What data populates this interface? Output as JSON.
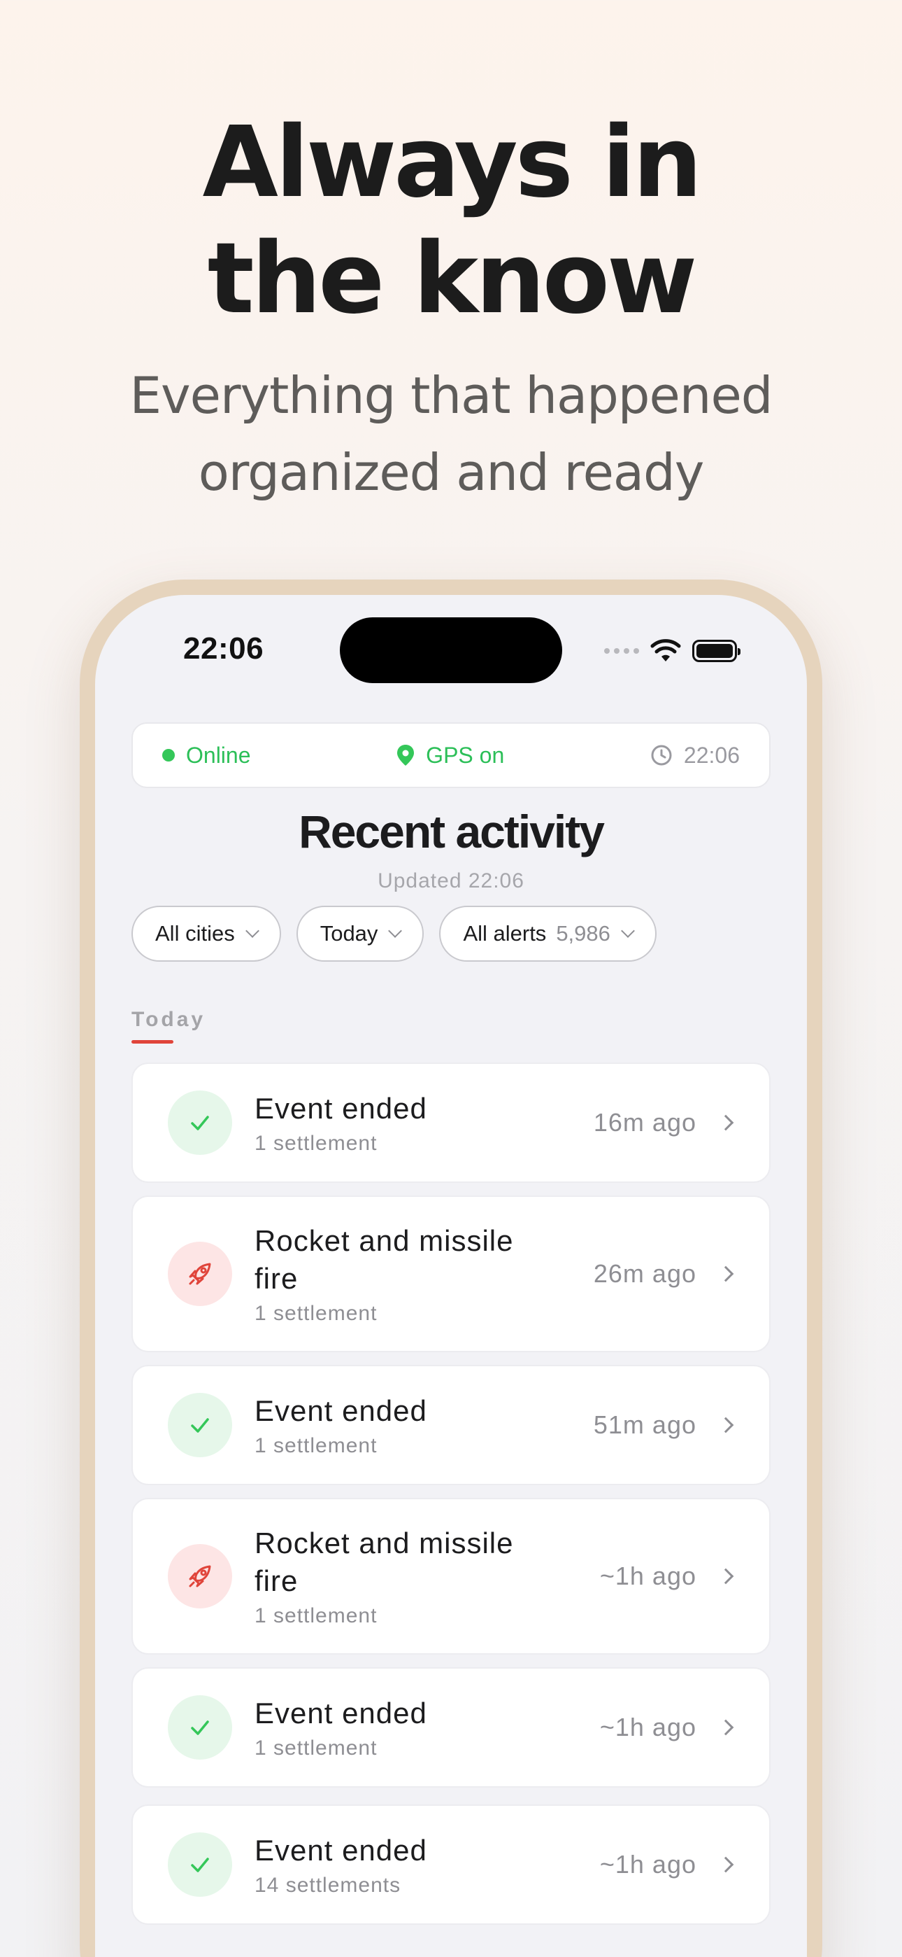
{
  "hero": {
    "title_line1": "Always in",
    "title_line2": "the know",
    "subtitle_line1": "Everything that happened",
    "subtitle_line2": "organized and ready"
  },
  "status_bar": {
    "time": "22:06"
  },
  "topbar": {
    "online": "Online",
    "gps": "GPS on",
    "clock": "22:06"
  },
  "page": {
    "title": "Recent activity",
    "updated": "Updated 22:06"
  },
  "filters": [
    {
      "label": "All cities"
    },
    {
      "label": "Today"
    },
    {
      "label": "All alerts",
      "count": "5,986"
    }
  ],
  "section": {
    "label": "Today"
  },
  "events": [
    {
      "type": "ended",
      "title": "Event ended",
      "sub": "1 settlement",
      "time": "16m ago"
    },
    {
      "type": "rocket",
      "title": "Rocket and missile fire",
      "sub": "1 settlement",
      "time": "26m ago"
    },
    {
      "type": "ended",
      "title": "Event ended",
      "sub": "1 settlement",
      "time": "51m ago"
    },
    {
      "type": "rocket",
      "title": "Rocket and missile fire",
      "sub": "1 settlement",
      "time": "~1h ago"
    },
    {
      "type": "ended",
      "title": "Event ended",
      "sub": "1 settlement",
      "time": "~1h ago"
    },
    {
      "type": "ended",
      "title": "Event ended",
      "sub": "14 settlements",
      "time": "~1h ago"
    }
  ],
  "icons": {
    "ended": "checkmark-icon",
    "rocket": "rocket-icon"
  },
  "colors": {
    "accent_green": "#34c759",
    "accent_red": "#e0443a",
    "frame": "#e6d4bd"
  }
}
